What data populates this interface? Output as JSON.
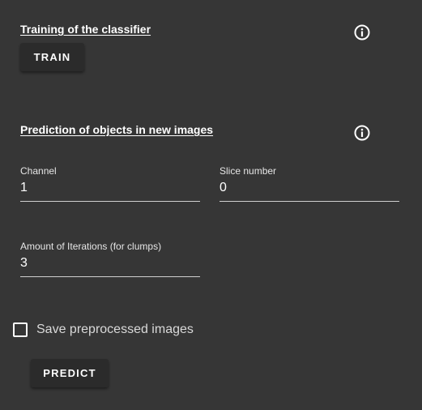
{
  "training": {
    "title": "Training of the classifier",
    "train_button": "TRAIN"
  },
  "prediction": {
    "title": "Prediction of objects in new images",
    "fields": {
      "channel": {
        "label": "Channel",
        "value": "1"
      },
      "slice": {
        "label": "Slice number",
        "value": "0"
      },
      "iterations": {
        "label": "Amount of Iterations (for clumps)",
        "value": "3"
      }
    },
    "save_checkbox": {
      "label": "Save preprocessed images",
      "checked": false
    },
    "predict_button": "PREDICT"
  },
  "icons": {
    "info": "info-circle-icon"
  },
  "colors": {
    "background": "#363636",
    "button": "#2b2b2b",
    "text": "#ffffff",
    "underline": "#d0d0d0"
  }
}
